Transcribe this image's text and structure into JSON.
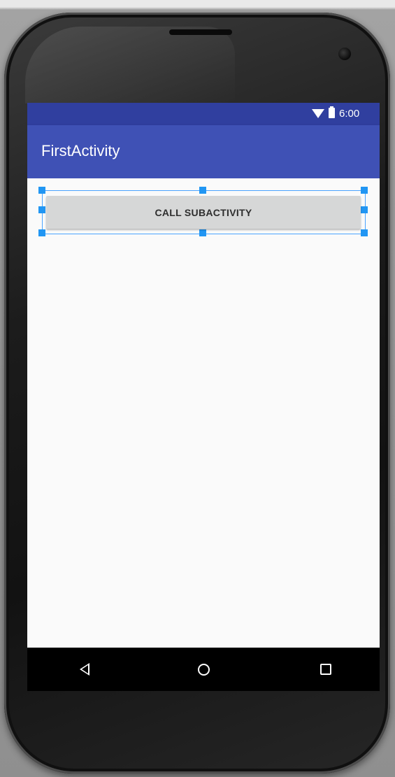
{
  "status_bar": {
    "time": "6:00",
    "icons": [
      "wifi-icon",
      "battery-icon"
    ]
  },
  "app_bar": {
    "title": "FirstActivity"
  },
  "main": {
    "call_button_label": "CALL SUBACTIVITY"
  },
  "nav_bar": {
    "icons": [
      "back-icon",
      "home-icon",
      "recents-icon"
    ]
  },
  "colors": {
    "status_bar": "#303f9f",
    "app_bar": "#3f51b5",
    "button": "#d6d7d7",
    "selection": "#2196f3",
    "background": "#fafafa"
  }
}
